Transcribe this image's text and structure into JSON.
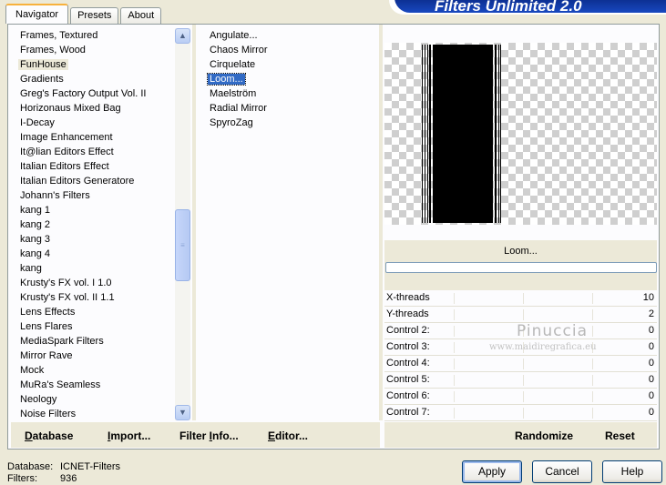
{
  "tabs": [
    "Navigator",
    "Presets",
    "About"
  ],
  "banner_title": "Filters Unlimited 2.0",
  "categories": [
    "Frames, Textured",
    "Frames, Wood",
    "FunHouse",
    "Gradients",
    "Greg's Factory Output Vol. II",
    "Horizonaus Mixed Bag",
    "I-Decay",
    "Image Enhancement",
    "It@lian Editors Effect",
    "Italian Editors Effect",
    "Italian Editors Generatore",
    "Johann's Filters",
    "kang 1",
    "kang 2",
    "kang 3",
    "kang 4",
    "kang",
    "Krusty's FX vol. I 1.0",
    "Krusty's FX vol. II 1.1",
    "Lens Effects",
    "Lens Flares",
    "MediaSpark Filters",
    "Mirror Rave",
    "Mock",
    "MuRa's Seamless",
    "Neology",
    "Noise Filters"
  ],
  "selected_category": "FunHouse",
  "filters": [
    "Angulate...",
    "Chaos Mirror",
    "Cirquelate",
    "Loom...",
    "Maelström",
    "Radial Mirror",
    "SpyroZag"
  ],
  "selected_filter": "Loom...",
  "preview_filter_name": "Loom...",
  "controls": [
    {
      "label": "X-threads",
      "value": "10"
    },
    {
      "label": "Y-threads",
      "value": "2"
    },
    {
      "label": "Control 2:",
      "value": "0"
    },
    {
      "label": "Control 3:",
      "value": "0"
    },
    {
      "label": "Control 4:",
      "value": "0"
    },
    {
      "label": "Control 5:",
      "value": "0"
    },
    {
      "label": "Control 6:",
      "value": "0"
    },
    {
      "label": "Control 7:",
      "value": "0"
    }
  ],
  "watermark": {
    "name": "Pinuccia",
    "url": "www.maidiregrafica.eu"
  },
  "actions": {
    "database": {
      "u": "D",
      "rest": "atabase"
    },
    "import": {
      "u": "I",
      "rest": "mport..."
    },
    "filter_info": {
      "pre": "Filter ",
      "u": "I",
      "rest": "nfo..."
    },
    "editor": {
      "u": "E",
      "rest": "ditor..."
    },
    "randomize": "Randomize",
    "reset": "Reset"
  },
  "footer": {
    "database_label": "Database:",
    "database_value": "ICNET-Filters",
    "filters_label": "Filters:",
    "filters_value": "936"
  },
  "buttons": {
    "apply": "Apply",
    "cancel": "Cancel",
    "help": "Help"
  }
}
